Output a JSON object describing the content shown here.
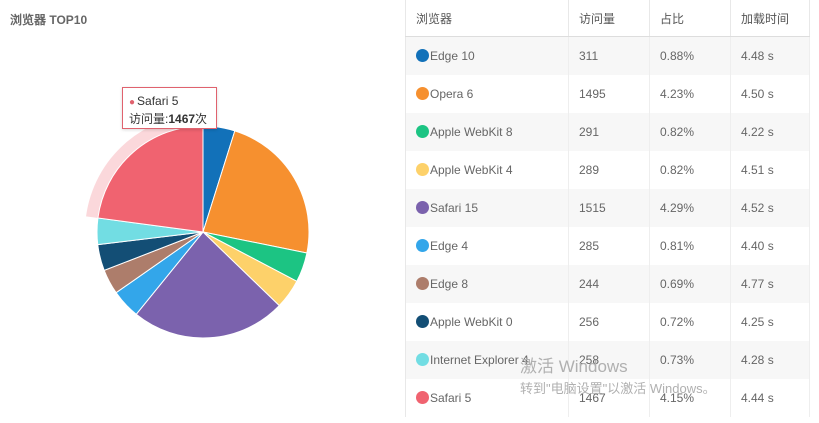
{
  "card": {
    "title": "浏览器 TOP10"
  },
  "tooltip": {
    "name": "Safari 5",
    "metric_label": "访问量:",
    "value": "1467",
    "unit": "次"
  },
  "table": {
    "headers": [
      "浏览器",
      "访问量",
      "占比",
      "加载时间"
    ],
    "rows": [
      {
        "name": "Edge 10",
        "visits": "311",
        "ratio": "0.88%",
        "load": "4.48 s"
      },
      {
        "name": "Opera 6",
        "visits": "1495",
        "ratio": "4.23%",
        "load": "4.50 s"
      },
      {
        "name": "Apple WebKit 8",
        "visits": "291",
        "ratio": "0.82%",
        "load": "4.22 s"
      },
      {
        "name": "Apple WebKit 4",
        "visits": "289",
        "ratio": "0.82%",
        "load": "4.51 s"
      },
      {
        "name": "Safari 15",
        "visits": "1515",
        "ratio": "4.29%",
        "load": "4.52 s"
      },
      {
        "name": "Edge 4",
        "visits": "285",
        "ratio": "0.81%",
        "load": "4.40 s"
      },
      {
        "name": "Edge 8",
        "visits": "244",
        "ratio": "0.69%",
        "load": "4.77 s"
      },
      {
        "name": "Apple WebKit 0",
        "visits": "256",
        "ratio": "0.72%",
        "load": "4.25 s"
      },
      {
        "name": "Internet Explorer 4",
        "visits": "258",
        "ratio": "0.73%",
        "load": "4.28 s"
      },
      {
        "name": "Safari 5",
        "visits": "1467",
        "ratio": "4.15%",
        "load": "4.44 s"
      }
    ]
  },
  "watermark": {
    "line1": "激活 Windows",
    "line2": "转到\"电脑设置\"以激活 Windows。"
  },
  "chart_data": {
    "type": "pie",
    "title": "浏览器 TOP10",
    "categories": [
      "Edge 10",
      "Opera 6",
      "Apple WebKit 8",
      "Apple WebKit 4",
      "Safari 15",
      "Edge 4",
      "Edge 8",
      "Apple WebKit 0",
      "Internet Explorer 4",
      "Safari 5"
    ],
    "values": [
      311,
      1495,
      291,
      289,
      1515,
      285,
      244,
      256,
      258,
      1467
    ],
    "colors": [
      "#1271b9",
      "#f6902f",
      "#1cc483",
      "#fdd16a",
      "#7b62ad",
      "#33a6ea",
      "#ad7d6b",
      "#134e75",
      "#72dde3",
      "#f06370"
    ],
    "highlighted": "Safari 5",
    "legend": "none"
  }
}
